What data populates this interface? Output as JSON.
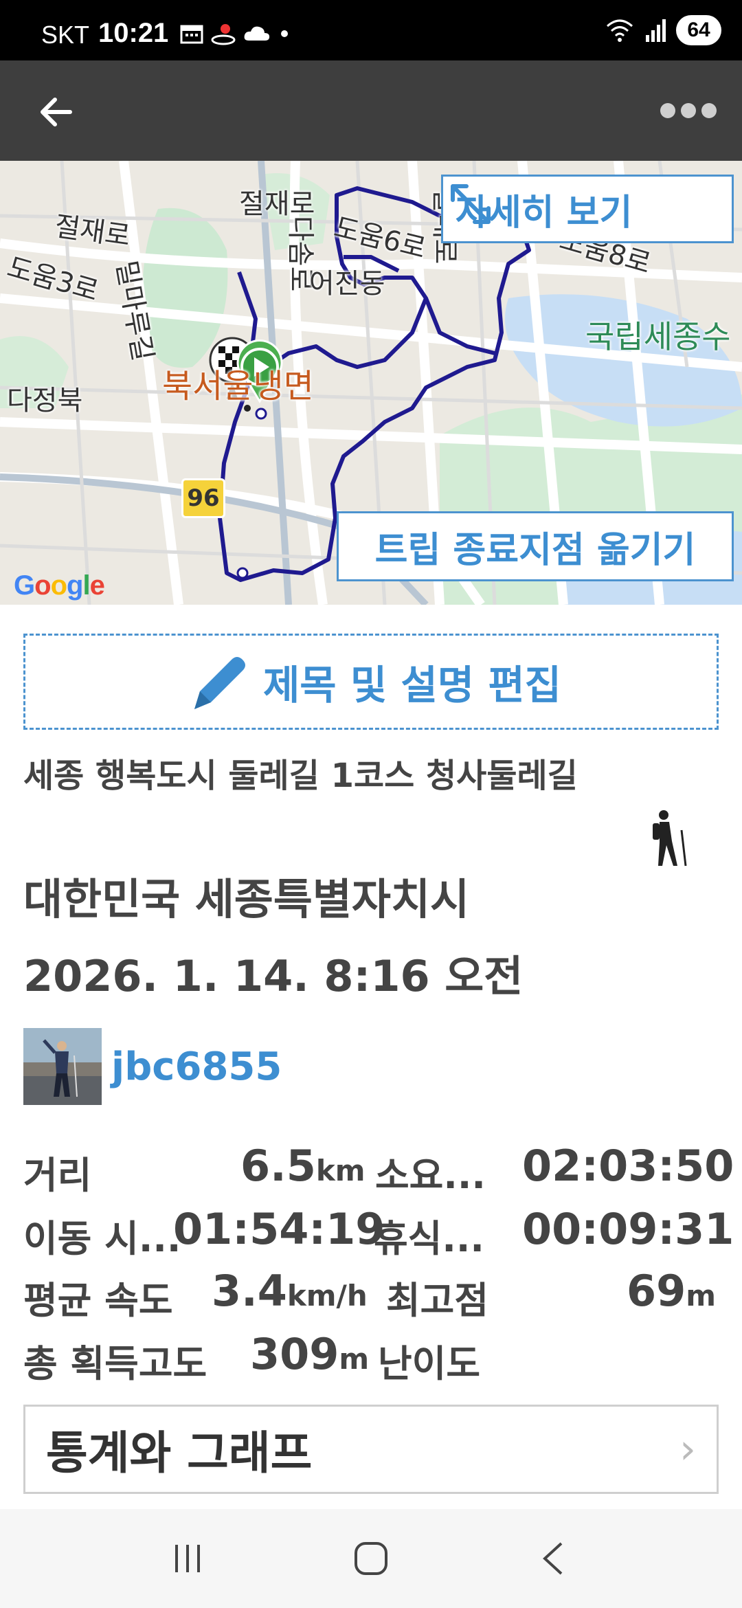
{
  "status_bar": {
    "carrier": "SKT",
    "time": "10:21",
    "battery": "64"
  },
  "app_bar": {
    "back_icon": "arrow-left-icon",
    "more_icon": "more-dots-icon"
  },
  "map": {
    "labels": {
      "road1": "절재로",
      "road2": "절재로",
      "road3": "도움3로",
      "road4": "밀마루길",
      "road5": "다솜로",
      "road6": "도움6로",
      "road7": "갈매로",
      "road8": "도움8로",
      "dong": "어진동",
      "park": "국립세종수",
      "place": "북서울냉면",
      "bottom": "다정북"
    },
    "route_number": "96",
    "detail_button": "자세히 보기",
    "move_end_button": "트립 종료지점 옮기기",
    "google": "Google",
    "route_color": "#1f1a8f"
  },
  "edit": {
    "label": "제목 및 설명 편집",
    "icon": "pencil-icon"
  },
  "trip": {
    "title": "세종 행복도시 둘레길 1코스 청사둘레길",
    "location": "대한민국 세종특별자치시",
    "datetime": "2026. 1. 14. 8:16 오전",
    "activity_icon": "hiking-icon",
    "user": "jbc6855"
  },
  "stats": {
    "distance_label": "거리",
    "distance_value": "6.5",
    "distance_unit": "km",
    "total_time_label": "소요...",
    "total_time_value": "02:03:50",
    "moving_label": "이동 시...",
    "moving_value": "01:54:19",
    "rest_label": "휴식...",
    "rest_value": "00:09:31",
    "avg_speed_label": "평균 속도",
    "avg_speed_value": "3.4",
    "avg_speed_unit": "km/h",
    "max_alt_label": "최고점",
    "max_alt_value": "69",
    "max_alt_unit": "m",
    "gain_label": "총 획득고도",
    "gain_value": "309",
    "gain_unit": "m",
    "difficulty_label": "난이도"
  },
  "graph_button": {
    "label": "통계와 그래프",
    "chevron": "›"
  },
  "colors": {
    "accent": "#3d8ed1",
    "app_bar": "#3e3e3e"
  }
}
